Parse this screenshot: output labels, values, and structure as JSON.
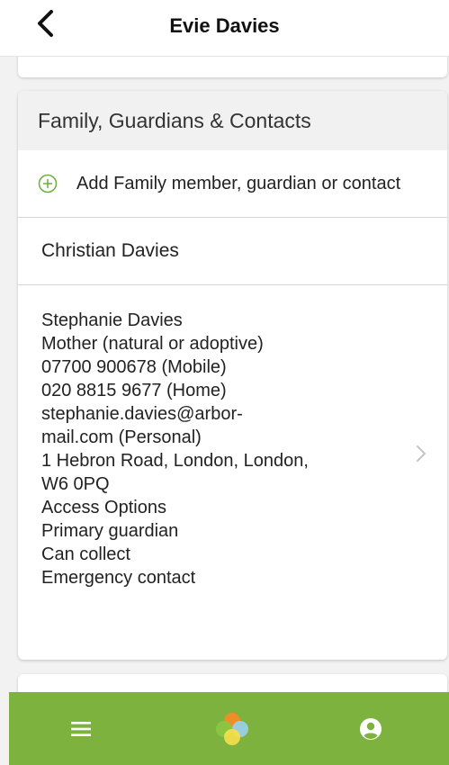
{
  "header": {
    "title": "Evie Davies",
    "back_icon": "chevron-left-icon"
  },
  "section": {
    "title": "Family, Guardians & Contacts",
    "add_label": "Add Family member, guardian or contact",
    "add_icon": "plus-circle-icon"
  },
  "contacts": {
    "first": {
      "name": "Christian Davies"
    },
    "second": {
      "lines": [
        "Stephanie Davies",
        "Mother (natural or adoptive)",
        "07700 900678 (Mobile)",
        "020 8815 9677 (Home)",
        "stephanie.davies@arbor-",
        "mail.com (Personal)",
        "1 Hebron Road, London, London,",
        "W6 0PQ",
        "Access Options",
        "Primary guardian",
        "Can collect",
        "Emergency contact"
      ],
      "chevron_icon": "chevron-right-icon"
    }
  },
  "bottom_nav": {
    "menu_icon": "hamburger-menu-icon",
    "home_icon": "arbor-logo-icon",
    "profile_icon": "user-circle-icon"
  },
  "colors": {
    "accent_green": "#7db23f",
    "plus_green": "#6cae3a"
  }
}
